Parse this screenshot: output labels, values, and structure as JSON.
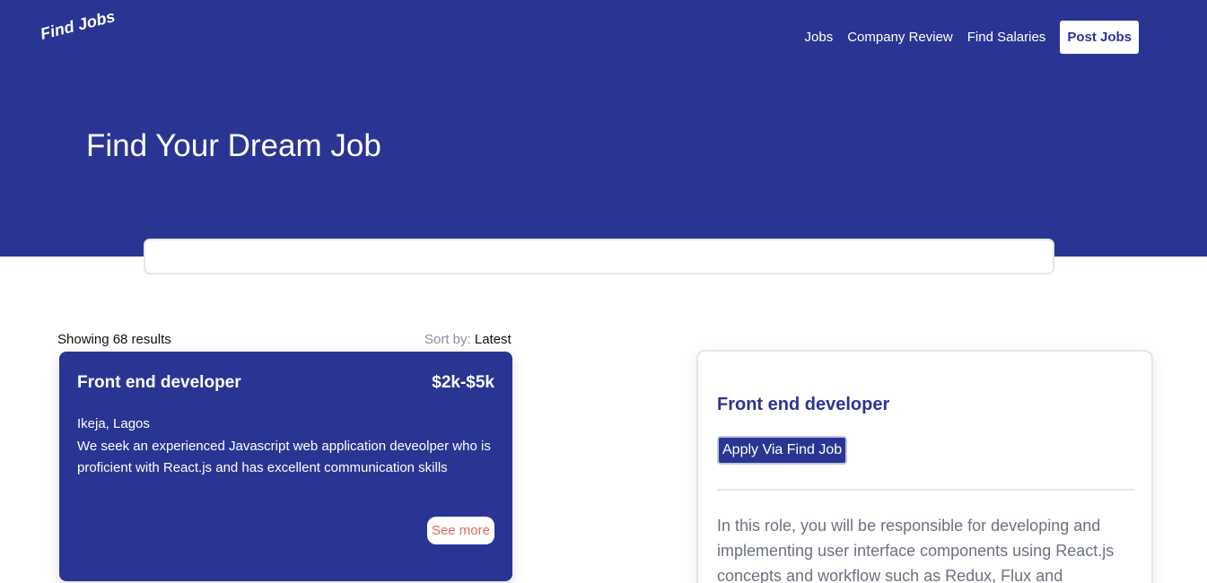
{
  "brand": {
    "logo_text": "Find Jobs"
  },
  "nav": {
    "items": [
      "Jobs",
      "Company Review",
      "Find Salaries"
    ],
    "cta_label": "Post Jobs"
  },
  "hero": {
    "title": "Find Your Dream Job"
  },
  "search": {
    "value": "",
    "placeholder": ""
  },
  "results": {
    "count_text": "Showing 68 results",
    "sort_label": "Sort by:",
    "sort_value": "Latest"
  },
  "job_card": {
    "title": "Front end developer",
    "salary": "$2k-$5k",
    "location": "Ikeja, Lagos",
    "description": "We seek an experienced Javascript web application deveolper who is proficient with React.js and has excellent communication skills",
    "see_more_label": "See more"
  },
  "detail": {
    "title": "Front end developer",
    "apply_label": "Apply Via Find Job",
    "description": "In this role, you will be responsible for developing and implementing user interface components using React.js concepts and workflow such as Redux, Flux and"
  },
  "colors": {
    "primary": "#2a3593",
    "see_more_text": "#e06c5f",
    "muted_text": "#6b7280"
  }
}
